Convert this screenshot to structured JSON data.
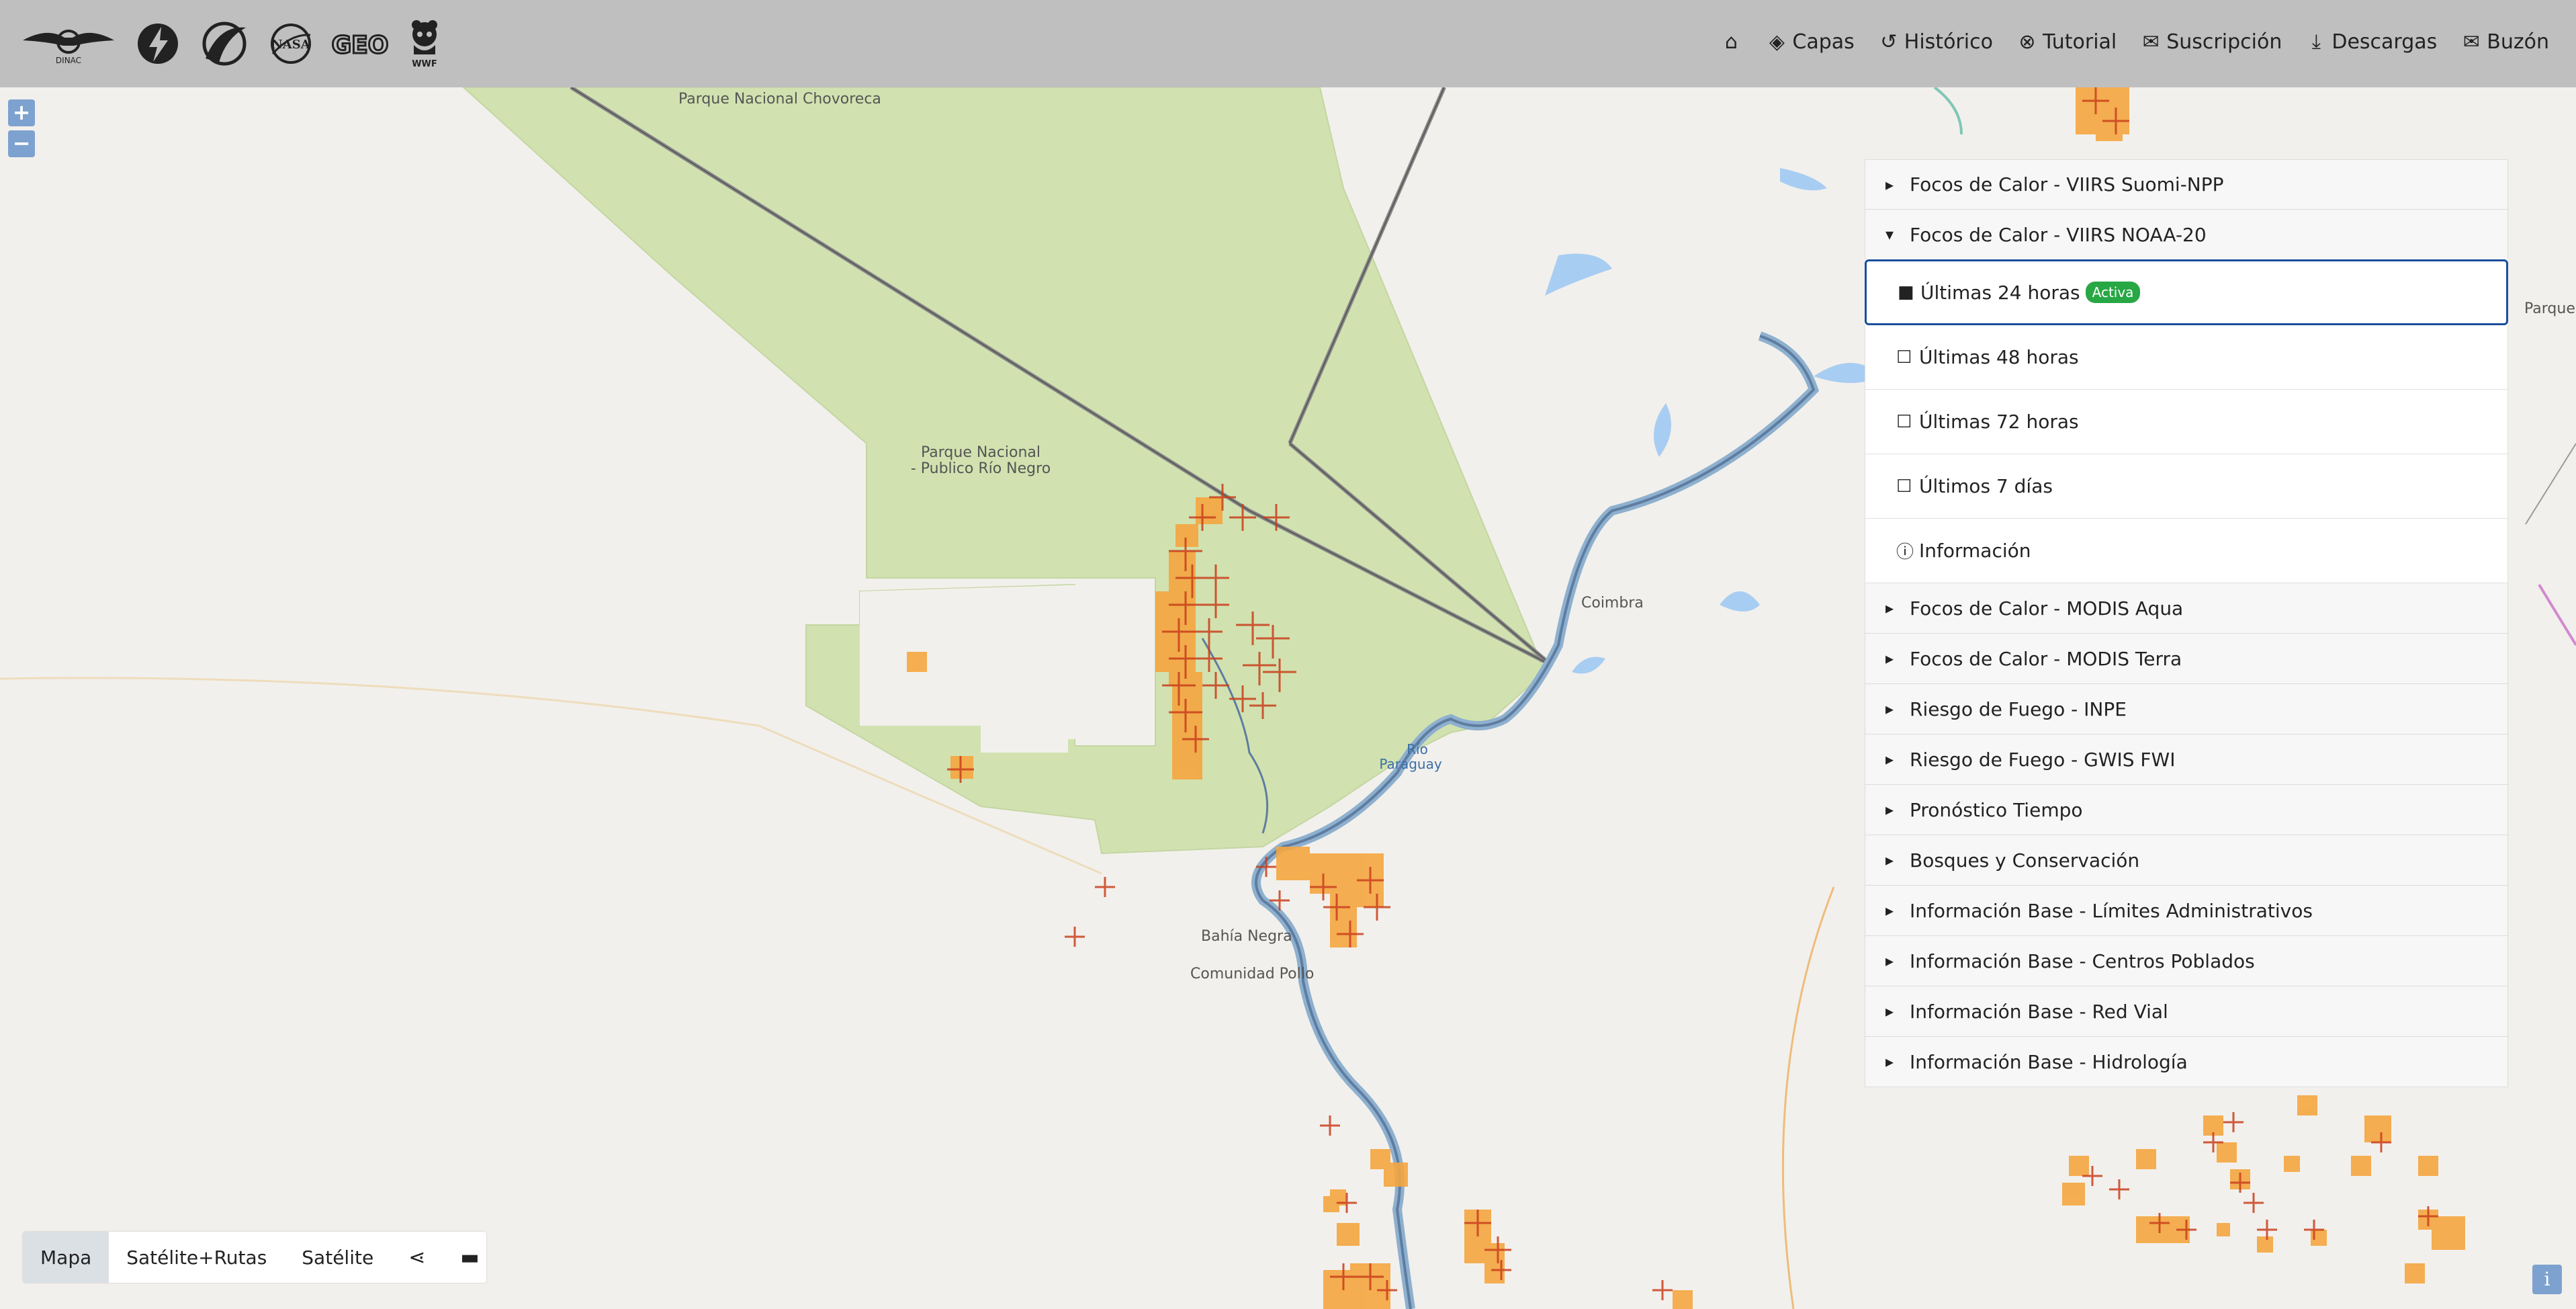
{
  "nav": {
    "logos": [
      "dinac-logo",
      "lightning-logo",
      "agency-logo",
      "nasa-logo",
      "geo-logo",
      "wwf-logo"
    ],
    "logo_texts": {
      "dinac": "DINAC",
      "nasa": "NASA",
      "geo": "GEO",
      "wwf": "WWF"
    },
    "items": [
      {
        "icon": "home-icon",
        "label": ""
      },
      {
        "icon": "layers-icon",
        "label": "Capas"
      },
      {
        "icon": "history-icon",
        "label": "Histórico"
      },
      {
        "icon": "help-circle-icon",
        "label": "Tutorial"
      },
      {
        "icon": "envelope-icon",
        "label": "Suscripción"
      },
      {
        "icon": "download-icon",
        "label": "Descargas"
      },
      {
        "icon": "envelope-icon",
        "label": "Buzón"
      }
    ]
  },
  "map": {
    "labels": {
      "chovoreca": "Parque Nacional Chovoreca",
      "rio_negro_1": "Parque Nacional",
      "rio_negro_2": "- Publico Río Negro",
      "coimbra": "Coimbra",
      "rio_paraguay_1": "Río",
      "rio_paraguay_2": "Paraguay",
      "bahia_negra": "Bahía Negra",
      "comunidad_pollo": "Comunidad Pollo",
      "parque_right": "Parque"
    },
    "colors": {
      "park": "#d1e2b0",
      "water": "#a8cdf2",
      "fire_orange": "#f5a640",
      "fire_red": "#c93e1c",
      "background": "#f2f0ec"
    }
  },
  "zoom": {
    "in": "+",
    "out": "−"
  },
  "layers": {
    "groups": [
      {
        "label": "Focos de Calor - VIIRS Suomi-NPP",
        "expanded": false
      },
      {
        "label": "Focos de Calor - VIIRS NOAA-20",
        "expanded": true
      },
      {
        "label": "Focos de Calor - MODIS Aqua",
        "expanded": false
      },
      {
        "label": "Focos de Calor - MODIS Terra",
        "expanded": false
      },
      {
        "label": "Riesgo de Fuego - INPE",
        "expanded": false
      },
      {
        "label": "Riesgo de Fuego - GWIS FWI",
        "expanded": false
      },
      {
        "label": "Pronóstico Tiempo",
        "expanded": false
      },
      {
        "label": "Bosques y Conservación",
        "expanded": false
      },
      {
        "label": "Información Base - Límites Administrativos",
        "expanded": false
      },
      {
        "label": "Información Base - Centros Poblados",
        "expanded": false
      },
      {
        "label": "Información Base - Red Vial",
        "expanded": false
      },
      {
        "label": "Información Base - Hidrología",
        "expanded": false
      }
    ],
    "sublayers": [
      {
        "label": "Últimas 24 horas",
        "checked": true,
        "badge": "Activa"
      },
      {
        "label": "Últimas 48 horas",
        "checked": false
      },
      {
        "label": "Últimas 72 horas",
        "checked": false
      },
      {
        "label": "Últimos 7 días",
        "checked": false
      },
      {
        "label": "Información",
        "info": true
      }
    ]
  },
  "basemap": {
    "options": [
      {
        "label": "Mapa",
        "active": true
      },
      {
        "label": "Satélite+Rutas",
        "active": false
      },
      {
        "label": "Satélite",
        "active": false
      }
    ],
    "tools": [
      "share-icon",
      "ruler-icon"
    ]
  },
  "info_button": "i"
}
